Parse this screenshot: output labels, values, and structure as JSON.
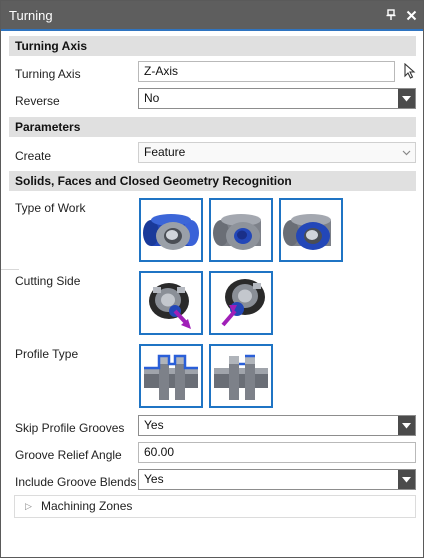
{
  "window": {
    "title": "Turning"
  },
  "sections": {
    "turning_axis": "Turning Axis",
    "parameters": "Parameters",
    "solids": "Solids, Faces and Closed Geometry Recognition"
  },
  "fields": {
    "turning_axis": {
      "label": "Turning Axis",
      "value": "Z-Axis"
    },
    "reverse": {
      "label": "Reverse",
      "value": "No"
    },
    "create": {
      "label": "Create",
      "value": "Feature"
    },
    "type_of_work": {
      "label": "Type of Work"
    },
    "cutting_side": {
      "label": "Cutting Side"
    },
    "profile_type": {
      "label": "Profile Type"
    },
    "skip_profile_grooves": {
      "label": "Skip Profile Grooves",
      "value": "Yes"
    },
    "groove_relief_angle": {
      "label": "Groove Relief Angle",
      "value": "60.00"
    },
    "include_groove_blends": {
      "label": "Include Groove Blends",
      "value": "Yes"
    }
  },
  "machining_zones": "Machining Zones",
  "colors": {
    "accent": "#1f74c4",
    "titlebar": "#5e5e5e",
    "highlight": "#2347b8",
    "arrow": "#a01fb8"
  }
}
